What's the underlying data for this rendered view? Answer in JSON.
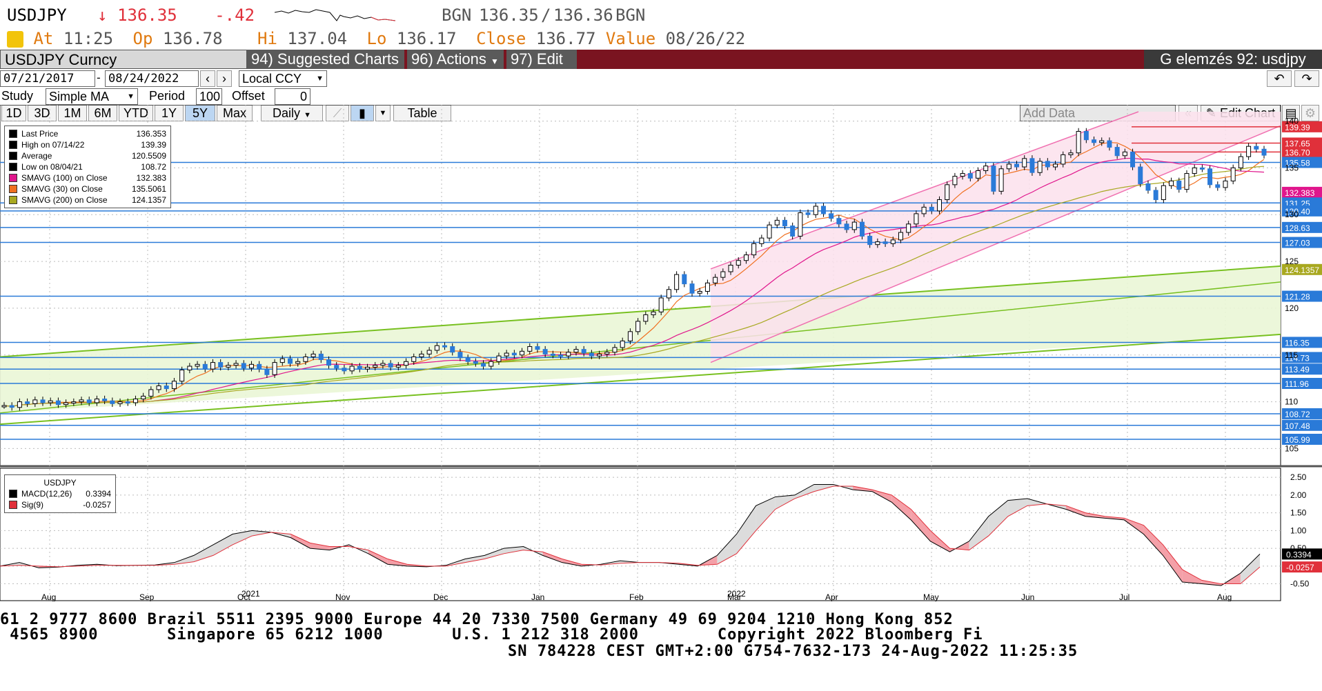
{
  "quote": {
    "symbol": "USDJPY",
    "arrow": "↓",
    "last": "136.35",
    "change": "-.42",
    "bid_src": "BGN",
    "bid": "136.35",
    "sep": "/",
    "ask": "136.36",
    "ask_src": "BGN"
  },
  "stats": {
    "at_label": "At",
    "at_value": "11:25",
    "op_label": "Op",
    "op_value": "136.78",
    "hi_label": "Hi",
    "hi_value": "137.04",
    "lo_label": "Lo",
    "lo_value": "136.17",
    "close_label": "Close",
    "close_value": "136.77",
    "value_label": "Value",
    "value_value": "08/26/22"
  },
  "toolbar": {
    "security": "USDJPY Curncy",
    "suggested": "94) Suggested Charts",
    "actions": "96) Actions",
    "edit": "97) Edit",
    "title_right": "G elemzés 92: usdjpy"
  },
  "range": {
    "from": "07/21/2017",
    "dash": "-",
    "to": "08/24/2022",
    "currency": "Local CCY"
  },
  "study": {
    "label": "Study",
    "value": "Simple MA",
    "period_label": "Period",
    "period_value": "100",
    "offset_label": "Offset",
    "offset_value": "0"
  },
  "periods": [
    "1D",
    "3D",
    "1M",
    "6M",
    "YTD",
    "1Y",
    "5Y",
    "Max"
  ],
  "selected_period": "5Y",
  "freq": "Daily",
  "table_label": "Table",
  "add_data_placeholder": "Add Data",
  "edit_chart": "Edit Chart",
  "chart_data": [
    {
      "type": "candlestick",
      "panel": "price",
      "legend": [
        {
          "label": "Last Price",
          "value": "136.353",
          "color": "#000000"
        },
        {
          "label": "High on 07/14/22",
          "value": "139.39",
          "color": "#000000"
        },
        {
          "label": "Average",
          "value": "120.5509",
          "color": "#000000"
        },
        {
          "label": "Low on 08/04/21",
          "value": "108.72",
          "color": "#000000"
        },
        {
          "label": "SMAVG (100)  on Close",
          "value": "132.383",
          "color": "#e0168c"
        },
        {
          "label": "SMAVG (30)  on Close",
          "value": "135.5061",
          "color": "#f07020"
        },
        {
          "label": "SMAVG (200)  on Close",
          "value": "124.1357",
          "color": "#a8a820"
        }
      ],
      "y_ticks": [
        140,
        135,
        130,
        125,
        120,
        115,
        110,
        105
      ],
      "ylim": [
        104,
        141
      ],
      "x_months": [
        "Aug",
        "Sep",
        "Oct",
        "Nov",
        "Dec",
        "Jan",
        "Feb",
        "Mar",
        "Apr",
        "May",
        "Jun",
        "Jul",
        "Aug"
      ],
      "x_years": [
        "2021",
        "2022"
      ],
      "series": [
        {
          "name": "Last Price",
          "values": [
            109.6,
            109.4,
            110.0,
            109.8,
            110.2,
            109.9,
            110.1,
            109.7,
            109.9,
            110.0,
            110.2,
            109.9,
            110.3,
            110.1,
            109.8,
            110.0,
            109.9,
            110.3,
            110.6,
            111.3,
            111.7,
            111.4,
            112.2,
            113.4,
            113.8,
            114.0,
            113.5,
            114.2,
            113.7,
            113.9,
            114.1,
            113.6,
            114.0,
            113.5,
            112.9,
            114.2,
            114.6,
            114.1,
            114.3,
            114.8,
            115.1,
            114.5,
            113.9,
            113.6,
            113.3,
            113.8,
            113.5,
            113.7,
            113.9,
            114.1,
            113.7,
            113.9,
            114.3,
            114.8,
            115.1,
            115.5,
            116.0,
            115.9,
            115.3,
            114.7,
            114.3,
            114.1,
            113.8,
            114.3,
            114.9,
            115.2,
            115.0,
            115.4,
            115.9,
            115.6,
            115.1,
            115.0,
            114.9,
            115.3,
            115.6,
            115.2,
            114.9,
            115.1,
            115.3,
            115.8,
            116.5,
            117.5,
            118.6,
            119.3,
            119.6,
            121.1,
            122.0,
            123.6,
            122.6,
            121.6,
            121.8,
            122.7,
            123.3,
            123.9,
            124.6,
            125.1,
            125.7,
            126.9,
            127.5,
            128.9,
            129.4,
            128.8,
            127.7,
            130.2,
            130.0,
            130.9,
            130.1,
            129.6,
            129.0,
            128.4,
            129.2,
            127.7,
            126.8,
            127.1,
            126.9,
            127.3,
            128.1,
            129.0,
            130.1,
            130.8,
            130.4,
            131.6,
            133.2,
            134.1,
            134.4,
            133.9,
            134.7,
            135.2,
            132.5,
            134.9,
            135.4,
            135.1,
            136.0,
            134.5,
            135.7,
            135.1,
            135.4,
            136.4,
            136.6,
            138.9,
            138.0,
            137.7,
            137.9,
            137.2,
            136.3,
            136.7,
            135.1,
            133.3,
            132.6,
            131.6,
            133.1,
            133.6,
            132.7,
            134.4,
            135.0,
            134.9,
            133.2,
            132.9,
            133.6,
            135.0,
            136.2,
            137.3,
            137.0,
            136.35
          ]
        },
        {
          "name": "SMAVG (100)  on Close",
          "values": [
            108.9,
            132.383
          ]
        },
        {
          "name": "SMAVG (30)  on Close",
          "values": [
            109.8,
            135.5061
          ]
        },
        {
          "name": "SMAVG (200)  on Close",
          "values": [
            106.5,
            124.1357
          ]
        }
      ],
      "price_tags": [
        {
          "value": "139.39",
          "color": "#e0303a"
        },
        {
          "value": "137.65",
          "color": "#e0303a"
        },
        {
          "value": "136.70",
          "color": "#e0303a"
        },
        {
          "value": "135.58",
          "color": "#2a7ad8"
        },
        {
          "value": "132.383",
          "color": "#e0168c"
        },
        {
          "value": "131.25",
          "color": "#2a7ad8"
        },
        {
          "value": "130.40",
          "color": "#2a7ad8"
        },
        {
          "value": "128.63",
          "color": "#2a7ad8"
        },
        {
          "value": "127.03",
          "color": "#2a7ad8"
        },
        {
          "value": "124.1357",
          "color": "#a8a820"
        },
        {
          "value": "121.28",
          "color": "#2a7ad8"
        },
        {
          "value": "116.35",
          "color": "#2a7ad8"
        },
        {
          "value": "114.73",
          "color": "#2a7ad8"
        },
        {
          "value": "113.49",
          "color": "#2a7ad8"
        },
        {
          "value": "111.96",
          "color": "#2a7ad8"
        },
        {
          "value": "108.72",
          "color": "#2a7ad8"
        },
        {
          "value": "107.48",
          "color": "#2a7ad8"
        },
        {
          "value": "105.99",
          "color": "#2a7ad8"
        }
      ]
    },
    {
      "type": "line",
      "panel": "macd",
      "title": "USDJPY",
      "legend": [
        {
          "label": "MACD(12,26)",
          "value": "0.3394",
          "color": "#000000"
        },
        {
          "label": "Sig(9)",
          "value": "-0.0257",
          "color": "#e0303a"
        }
      ],
      "y_ticks": [
        "2.50",
        "2.00",
        "1.50",
        "1.00",
        "0.50",
        "0.00",
        "-0.50"
      ],
      "ylim": [
        -0.8,
        2.6
      ],
      "series": [
        {
          "name": "MACD(12,26)",
          "values": [
            0.0,
            0.1,
            -0.05,
            -0.03,
            0.02,
            0.05,
            0.01,
            0.02,
            0.03,
            0.1,
            0.3,
            0.6,
            0.9,
            1.0,
            0.95,
            0.8,
            0.5,
            0.45,
            0.6,
            0.35,
            0.05,
            0.0,
            -0.02,
            0.02,
            0.2,
            0.3,
            0.5,
            0.55,
            0.3,
            0.1,
            0.0,
            0.05,
            0.15,
            0.1,
            0.1,
            0.05,
            0.0,
            0.3,
            0.9,
            1.7,
            1.95,
            2.0,
            2.3,
            2.3,
            2.15,
            2.1,
            1.8,
            1.3,
            0.7,
            0.4,
            0.7,
            1.4,
            1.85,
            1.9,
            1.75,
            1.6,
            1.4,
            1.35,
            1.3,
            0.9,
            0.3,
            -0.45,
            -0.5,
            -0.55,
            -0.2,
            0.3394
          ]
        },
        {
          "name": "Sig(9)",
          "values": [
            0.0,
            0.02,
            0.0,
            -0.02,
            0.0,
            0.02,
            0.02,
            0.02,
            0.02,
            0.05,
            0.12,
            0.3,
            0.6,
            0.85,
            0.95,
            0.9,
            0.65,
            0.55,
            0.55,
            0.45,
            0.2,
            0.05,
            0.0,
            0.0,
            0.1,
            0.2,
            0.35,
            0.45,
            0.4,
            0.2,
            0.05,
            0.03,
            0.08,
            0.1,
            0.1,
            0.08,
            0.02,
            0.05,
            0.35,
            1.0,
            1.6,
            1.9,
            2.1,
            2.25,
            2.25,
            2.15,
            2.0,
            1.6,
            1.0,
            0.5,
            0.45,
            0.85,
            1.4,
            1.7,
            1.75,
            1.7,
            1.5,
            1.4,
            1.35,
            1.15,
            0.6,
            -0.1,
            -0.4,
            -0.5,
            -0.5,
            -0.0257
          ]
        }
      ]
    }
  ],
  "footer": {
    "line1": "61 2 9777 8600 Brazil 5511 2395 9000 Europe 44 20 7330 7500 Germany 49 69 9204 1210 Hong Kong 852",
    "line2": " 4565 8900       Singapore 65 6212 1000       U.S. 1 212 318 2000        Copyright 2022 Bloomberg Fi",
    "line3": "SN 784228 CEST GMT+2:00 G754-7632-173 24-Aug-2022 11:25:35"
  }
}
